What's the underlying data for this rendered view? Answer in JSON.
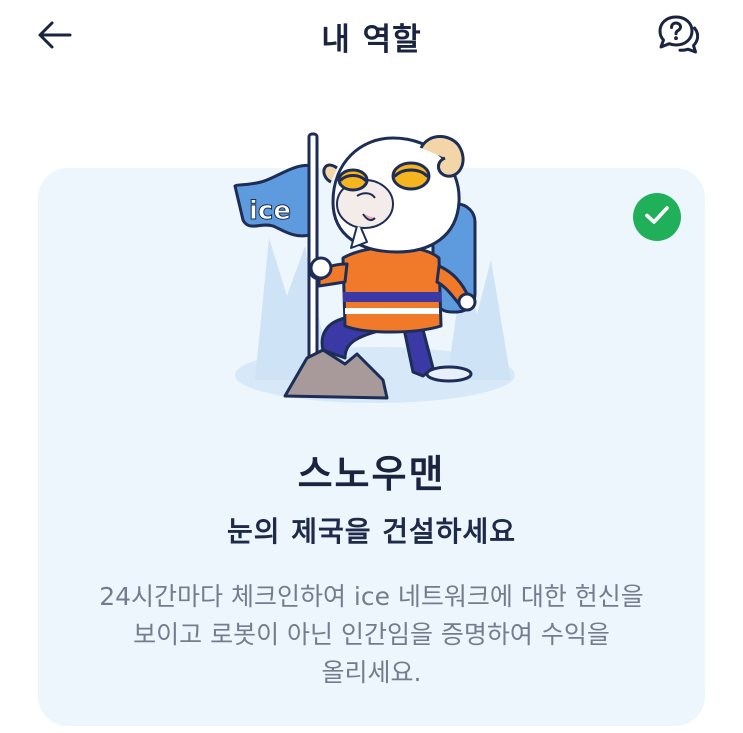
{
  "header": {
    "title": "내 역할",
    "back_icon": "arrow-left-icon",
    "help_icon": "help-chat-icon"
  },
  "card": {
    "role_name": "스노우맨",
    "subtitle": "눈의 제국을 건설하세요",
    "description": "24시간마다 체크인하여 ice 네트워크에 대한 헌신을\n보이고 로봇이 아닌 인간임을 증명하여 수익을\n올리세요.",
    "selected": true,
    "flag_text": "ice"
  },
  "colors": {
    "card_background": "#edf5fd",
    "title_text": "#1a2440",
    "body_text": "#757c8f",
    "check_badge": "#21b05a",
    "flag_blue": "#5d9bde",
    "jacket_orange": "#f07a2a"
  }
}
